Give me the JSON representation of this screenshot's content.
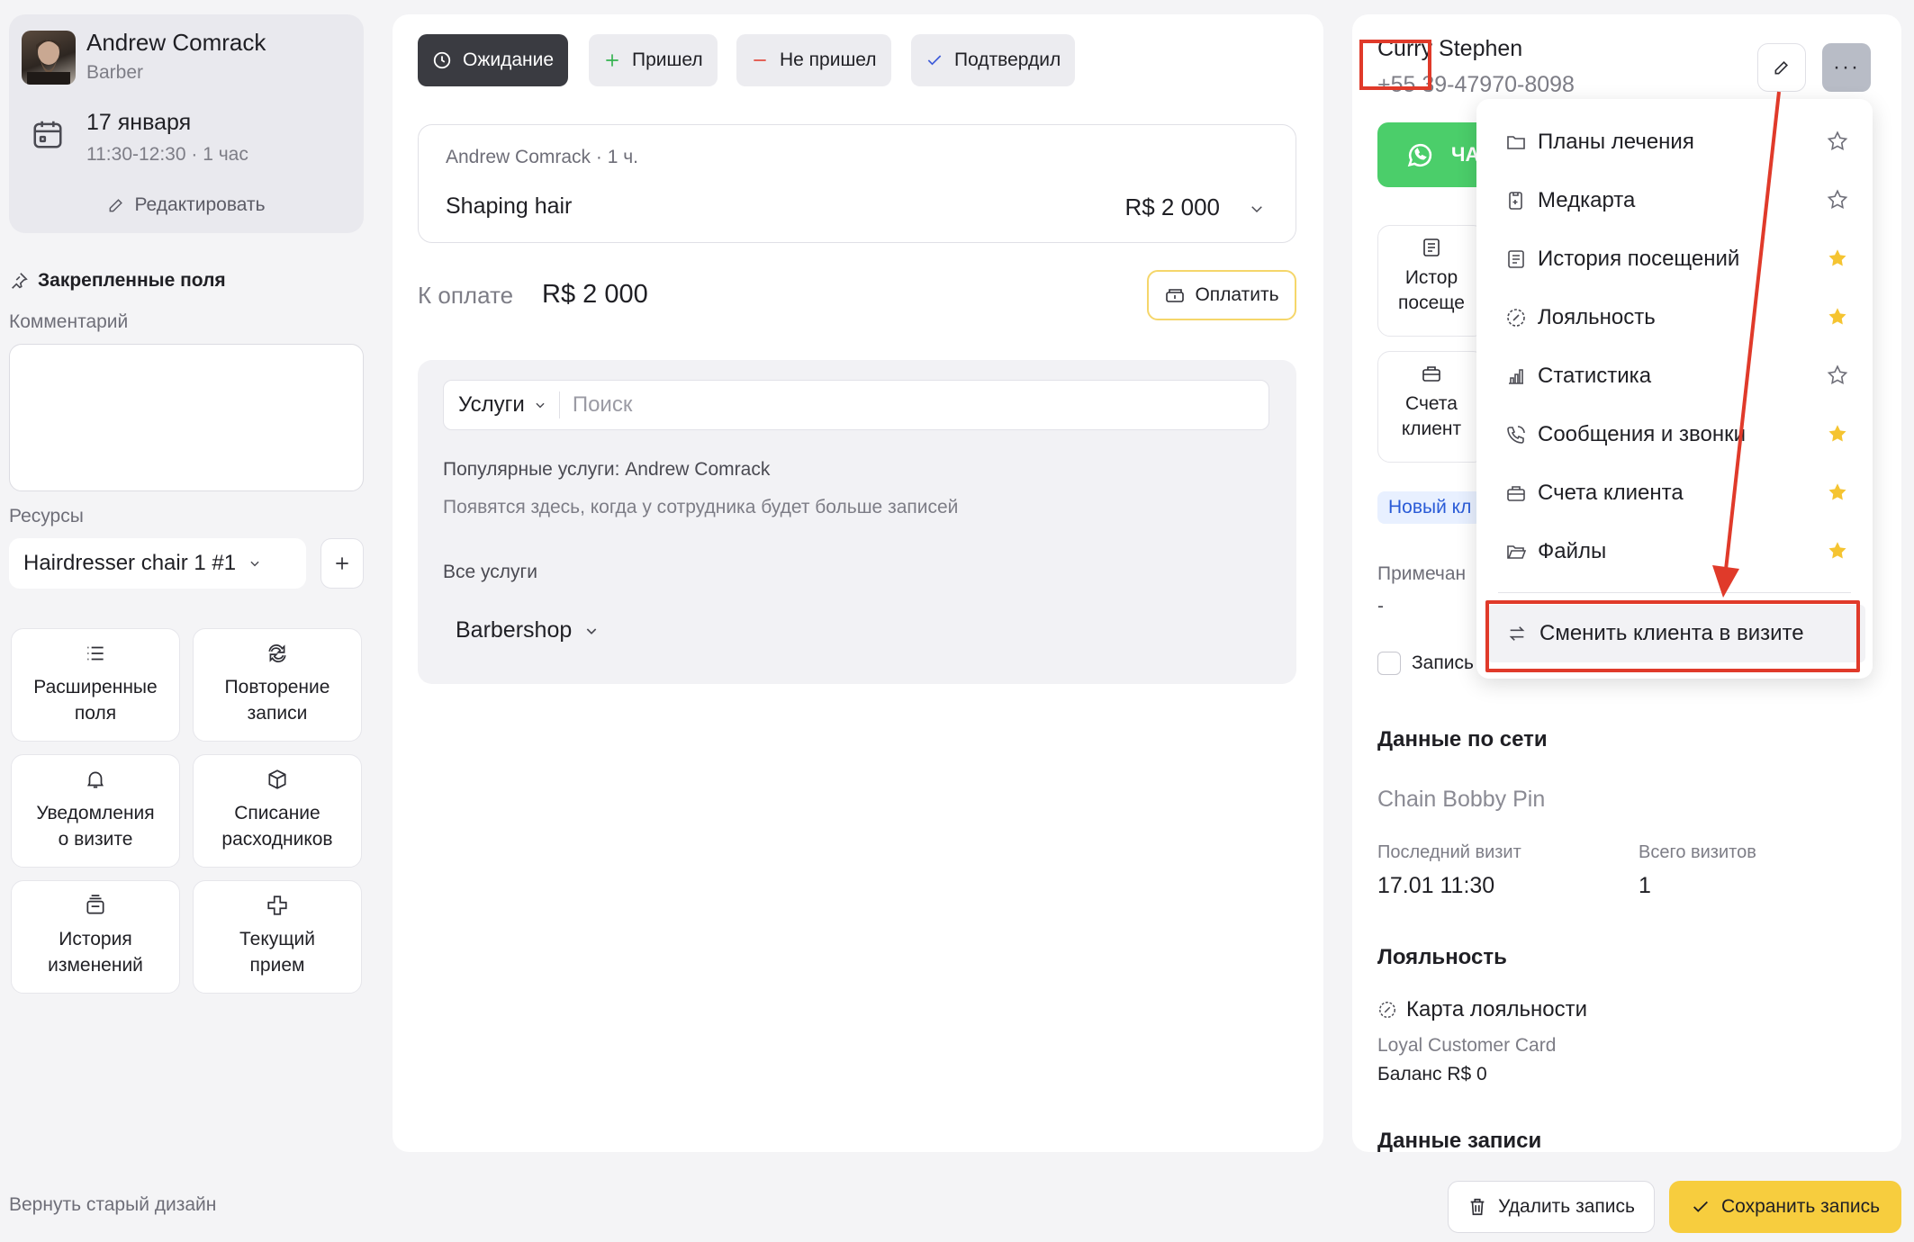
{
  "employee": {
    "name": "Andrew Comrack",
    "role": "Barber",
    "date": "17 января",
    "time": "11:30-12:30 · 1 час",
    "edit_label": "Редактировать"
  },
  "left": {
    "pinned_title": "Закрепленные поля",
    "comment_label": "Комментарий",
    "resources_label": "Ресурсы",
    "resource_value": "Hairdresser chair 1 #1",
    "tiles": [
      {
        "label": "Расширенные\nполя",
        "icon": "list-icon"
      },
      {
        "label": "Повторение\nзаписи",
        "icon": "repeat-icon"
      },
      {
        "label": "Уведомления\nо визите",
        "icon": "bell-icon"
      },
      {
        "label": "Списание\nрасходников",
        "icon": "box-icon"
      },
      {
        "label": "История\nизменений",
        "icon": "history-icon"
      },
      {
        "label": "Текущий\nприем",
        "icon": "medical-cross-icon"
      }
    ],
    "old_design": "Вернуть старый дизайн"
  },
  "status": {
    "waiting": "Ожидание",
    "arrived": "Пришел",
    "no_show": "Не пришел",
    "confirmed": "Подтвердил"
  },
  "service": {
    "meta": "Andrew Comrack · 1 ч.",
    "name": "Shaping hair",
    "price": "R$ 2 000"
  },
  "payment": {
    "label": "К оплате",
    "amount": "R$ 2 000",
    "pay_label": "Оплатить"
  },
  "services_box": {
    "dropdown": "Услуги",
    "search_placeholder": "Поиск",
    "popular_title": "Популярные услуги: Andrew Comrack",
    "popular_sub": "Появятся здесь, когда у сотрудника будет больше записей",
    "all_services": "Все услуги",
    "category": "Barbershop"
  },
  "client": {
    "name": "Curry Stephen",
    "phone": "+55 39-47970-8098",
    "wa_label": "ЧА",
    "tile1": "Истор\nпосеще",
    "tile2": "Счета\nклиент",
    "badge": "Новый кл",
    "note_label": "Примечан",
    "note_value": "-",
    "checkbox_label": "Запись"
  },
  "network": {
    "title": "Данные по сети",
    "chain": "Chain Bobby Pin",
    "last_visit_label": "Последний визит",
    "last_visit_value": "17.01 11:30",
    "total_visits_label": "Всего визитов",
    "total_visits_value": "1"
  },
  "loyalty": {
    "title": "Лояльность",
    "card_label": "Карта лояльности",
    "card_name": "Loyal Customer Card",
    "balance": "Баланс R$ 0"
  },
  "record_data_title": "Данные записи",
  "menu": {
    "items": [
      {
        "label": "Планы лечения",
        "icon": "folder-icon",
        "starred": false
      },
      {
        "label": "Медкарта",
        "icon": "medcard-icon",
        "starred": false
      },
      {
        "label": "История посещений",
        "icon": "history-list-icon",
        "starred": true
      },
      {
        "label": "Лояльность",
        "icon": "loyalty-icon",
        "starred": true
      },
      {
        "label": "Статистика",
        "icon": "stats-icon",
        "starred": false
      },
      {
        "label": "Сообщения и звонки",
        "icon": "phone-message-icon",
        "starred": true
      },
      {
        "label": "Счета клиента",
        "icon": "wallet-icon",
        "starred": true
      },
      {
        "label": "Файлы",
        "icon": "folder-open-icon",
        "starred": true
      }
    ],
    "switch_client": "Сменить клиента в визите"
  },
  "footer": {
    "delete": "Удалить запись",
    "save": "Сохранить запись"
  },
  "colors": {
    "accent_yellow": "#f7cd3e",
    "whatsapp_green": "#4bce6a",
    "annotation_red": "#e03a2a",
    "star_yellow": "#f5c431"
  }
}
